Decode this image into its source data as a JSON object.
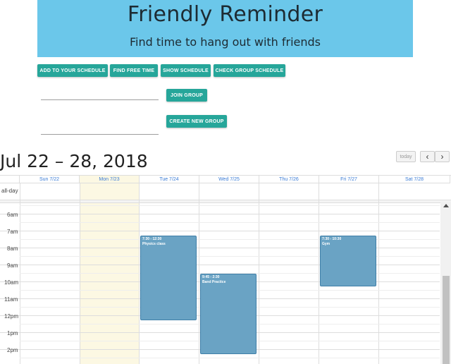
{
  "banner": {
    "title": "Friendly Reminder",
    "subtitle": "Find time to hang out with friends"
  },
  "toolbar": {
    "add_schedule": "ADD TO YOUR SCHEDULE",
    "find_free": "FIND FREE TIME",
    "show_schedule": "SHOW SCHEDULE",
    "check_group": "CHECK GROUP SCHEDULE"
  },
  "group": {
    "join_value": "",
    "join_button": "JOIN GROUP",
    "create_value": "",
    "create_button": "CREATE NEW GROUP"
  },
  "calendar": {
    "title": "Jul 22 – 28, 2018",
    "today_label": "today",
    "prev_icon": "chevron-left-icon",
    "next_icon": "chevron-right-icon",
    "prev_glyph": "‹",
    "next_glyph": "›",
    "days": [
      "Sun 7/22",
      "Mon 7/23",
      "Tue 7/24",
      "Wed 7/25",
      "Thu 7/26",
      "Fri 7/27",
      "Sat 7/28"
    ],
    "allday_label": "all-day",
    "times": [
      "6am",
      "7am",
      "8am",
      "9am",
      "10am",
      "11am",
      "12pm",
      "1pm",
      "2pm"
    ],
    "events": [
      {
        "time": "7:30 - 12:30",
        "title": "Physics class",
        "day": "Tue 7/24"
      },
      {
        "time": "9:45 - 2:30",
        "title": "Band Practice",
        "day": "Wed 7/25"
      },
      {
        "time": "7:30 - 10:30",
        "title": "Gym",
        "day": "Fri 7/27"
      }
    ]
  },
  "colors": {
    "banner": "#6bc7ea",
    "button": "#26a69a",
    "event": "#6aa3c4",
    "today_highlight": "#fcf8e3"
  }
}
